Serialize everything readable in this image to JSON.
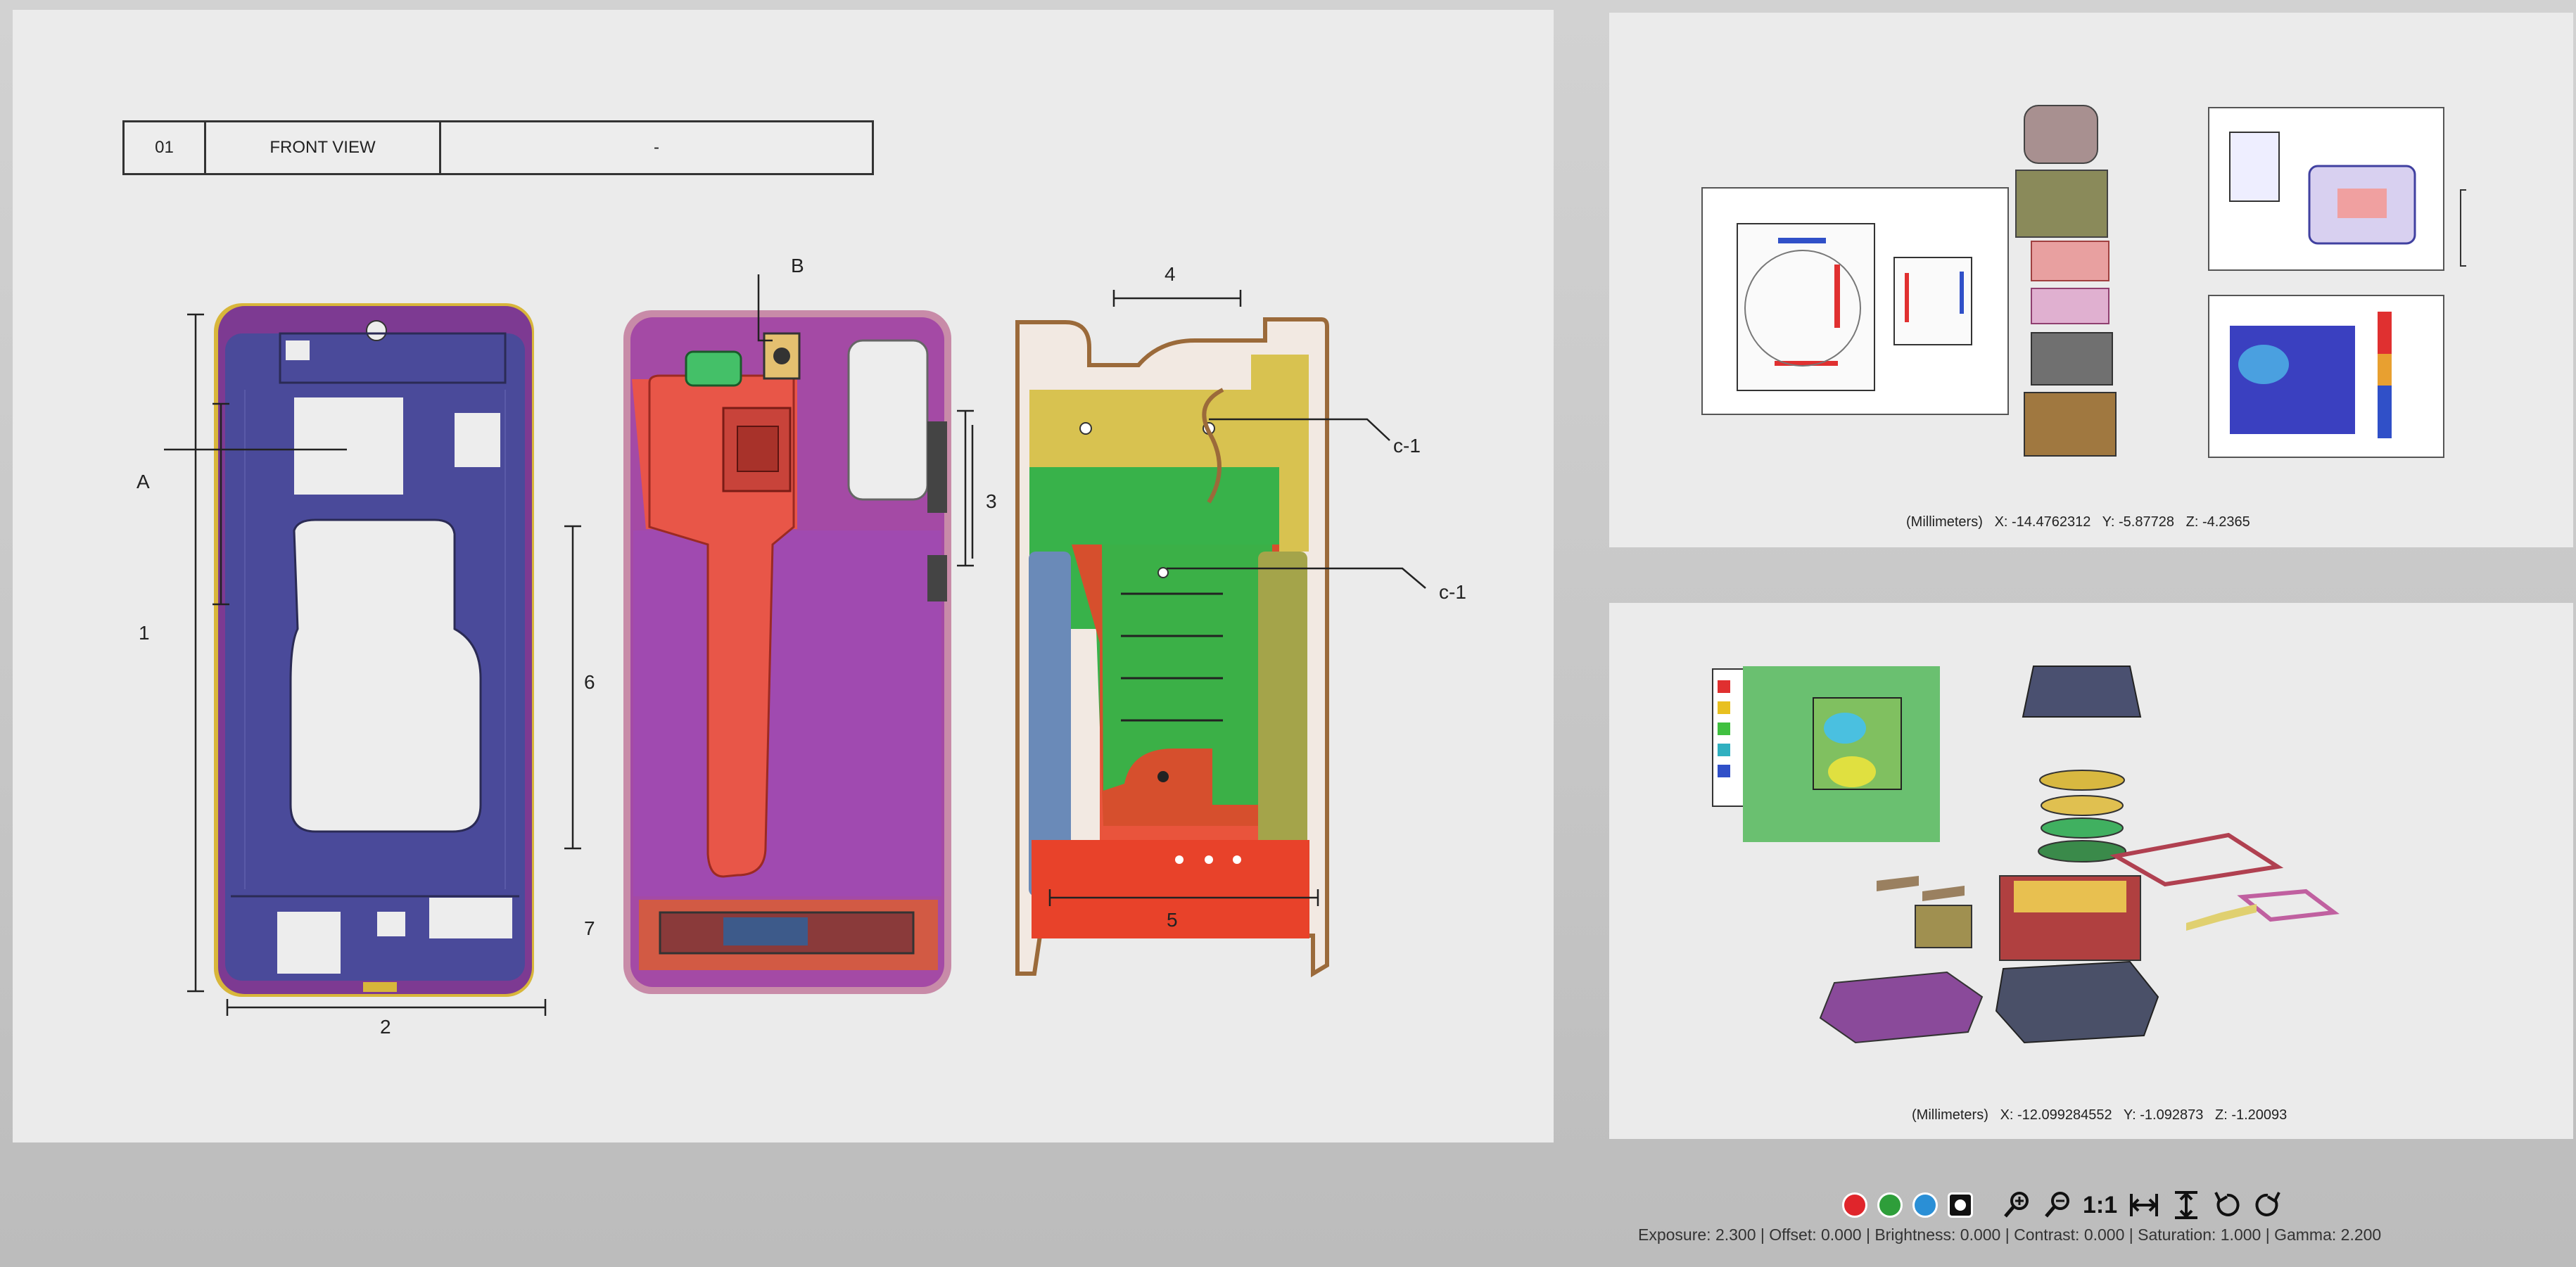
{
  "main": {
    "header": {
      "number": "01",
      "title": "FRONT VIEW",
      "note": "-"
    },
    "callouts": {
      "A": "A",
      "B": "B",
      "c1_top": "c-1",
      "c1_mid": "c-1",
      "dim1": "1",
      "dim2": "2",
      "dim3": "3",
      "dim4": "4",
      "dim5": "5",
      "dim6": "6",
      "dim7": "7"
    }
  },
  "top_right": {
    "readout": {
      "units": "(Millimeters)",
      "x": "X: -14.4762312",
      "y": "Y: -5.87728",
      "z": "Z: -4.2365"
    }
  },
  "bottom_right": {
    "readout": {
      "units": "(Millimeters)",
      "x": "X: -12.099284552",
      "y": "Y: -1.092873",
      "z": "Z: -1.20093"
    }
  },
  "toolbar": {
    "colors": {
      "red": "#e0252b",
      "green": "#2e9e3a",
      "blue": "#2a8fd6",
      "white": "#ffffff"
    },
    "ratio_label": "1:1",
    "icons": [
      "zoom-in-icon",
      "zoom-out-icon",
      "fit-width-icon",
      "fit-height-icon",
      "rotate-left-icon",
      "rotate-right-icon"
    ]
  },
  "status": {
    "exposure": "Exposure: 2.300",
    "offset": "Offset: 0.000",
    "brightness": "Brightness: 0.000",
    "contrast": "Contrast: 0.000",
    "saturation": "Saturation: 1.000",
    "gamma": "Gamma: 2.200",
    "separator": "|"
  }
}
